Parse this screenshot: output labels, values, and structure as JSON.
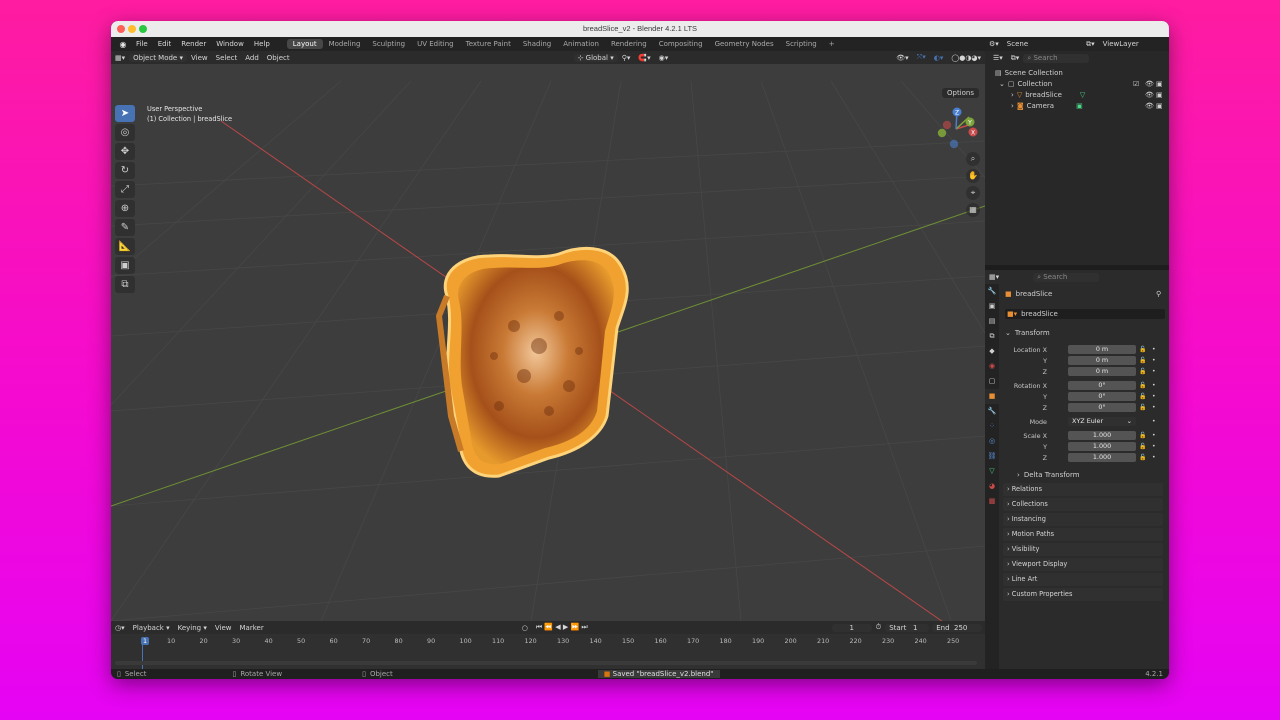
{
  "window": {
    "title": "breadSlice_v2 - Blender 4.2.1 LTS"
  },
  "menu": [
    "File",
    "Edit",
    "Render",
    "Window",
    "Help"
  ],
  "workspaces": [
    "Layout",
    "Modeling",
    "Sculpting",
    "UV Editing",
    "Texture Paint",
    "Shading",
    "Animation",
    "Rendering",
    "Compositing",
    "Geometry Nodes",
    "Scripting"
  ],
  "active_workspace": "Layout",
  "scene": {
    "label": "Scene",
    "view_layer": "ViewLayer"
  },
  "viewport": {
    "mode": "Object Mode",
    "menus": [
      "View",
      "Select",
      "Add",
      "Object"
    ],
    "transform_orientation": "Global",
    "overlay_line1": "User Perspective",
    "overlay_line2": "(1) Collection | breadSlice",
    "options_label": "Options",
    "axis_labels": {
      "x": "X",
      "y": "Y",
      "z": "Z"
    }
  },
  "outliner": {
    "search_placeholder": "Search",
    "root": "Scene Collection",
    "collection": "Collection",
    "items": [
      {
        "name": "breadSlice",
        "icon": "mesh-icon"
      },
      {
        "name": "Camera",
        "icon": "camera-icon"
      }
    ]
  },
  "properties": {
    "search_placeholder": "Search",
    "object_name": "breadSlice",
    "datablock_name": "breadSlice",
    "transform_label": "Transform",
    "location": {
      "label": "Location X",
      "x": "0 m",
      "y": "0 m",
      "z": "0 m"
    },
    "rotation": {
      "label": "Rotation X",
      "x": "0°",
      "y": "0°",
      "z": "0°"
    },
    "mode": {
      "label": "Mode",
      "value": "XYZ Euler"
    },
    "scale": {
      "label": "Scale X",
      "x": "1.000",
      "y": "1.000",
      "z": "1.000"
    },
    "axis_y": "Y",
    "axis_z": "Z",
    "delta_transform": "Delta Transform",
    "panels": [
      "Relations",
      "Collections",
      "Instancing",
      "Motion Paths",
      "Visibility",
      "Viewport Display",
      "Line Art",
      "Custom Properties"
    ]
  },
  "timeline": {
    "menus": [
      "Playback",
      "Keying",
      "View",
      "Marker"
    ],
    "current_frame": "1",
    "start_label": "Start",
    "start": "1",
    "end_label": "End",
    "end": "250",
    "ticks": [
      "1",
      "10",
      "20",
      "30",
      "40",
      "50",
      "60",
      "70",
      "80",
      "90",
      "100",
      "110",
      "120",
      "130",
      "140",
      "150",
      "160",
      "170",
      "180",
      "190",
      "200",
      "210",
      "220",
      "230",
      "240",
      "250"
    ]
  },
  "statusbar": {
    "left": "Select",
    "middle": "Rotate View",
    "right": "Object",
    "message": "Saved \"breadSlice_v2.blend\"",
    "version": "4.2.1"
  },
  "colors": {
    "accent": "#4772b3",
    "x_axis": "#c84a4a",
    "y_axis": "#7ea33a",
    "z_axis": "#4a7fcf",
    "toast_orange": "#d9750f"
  }
}
